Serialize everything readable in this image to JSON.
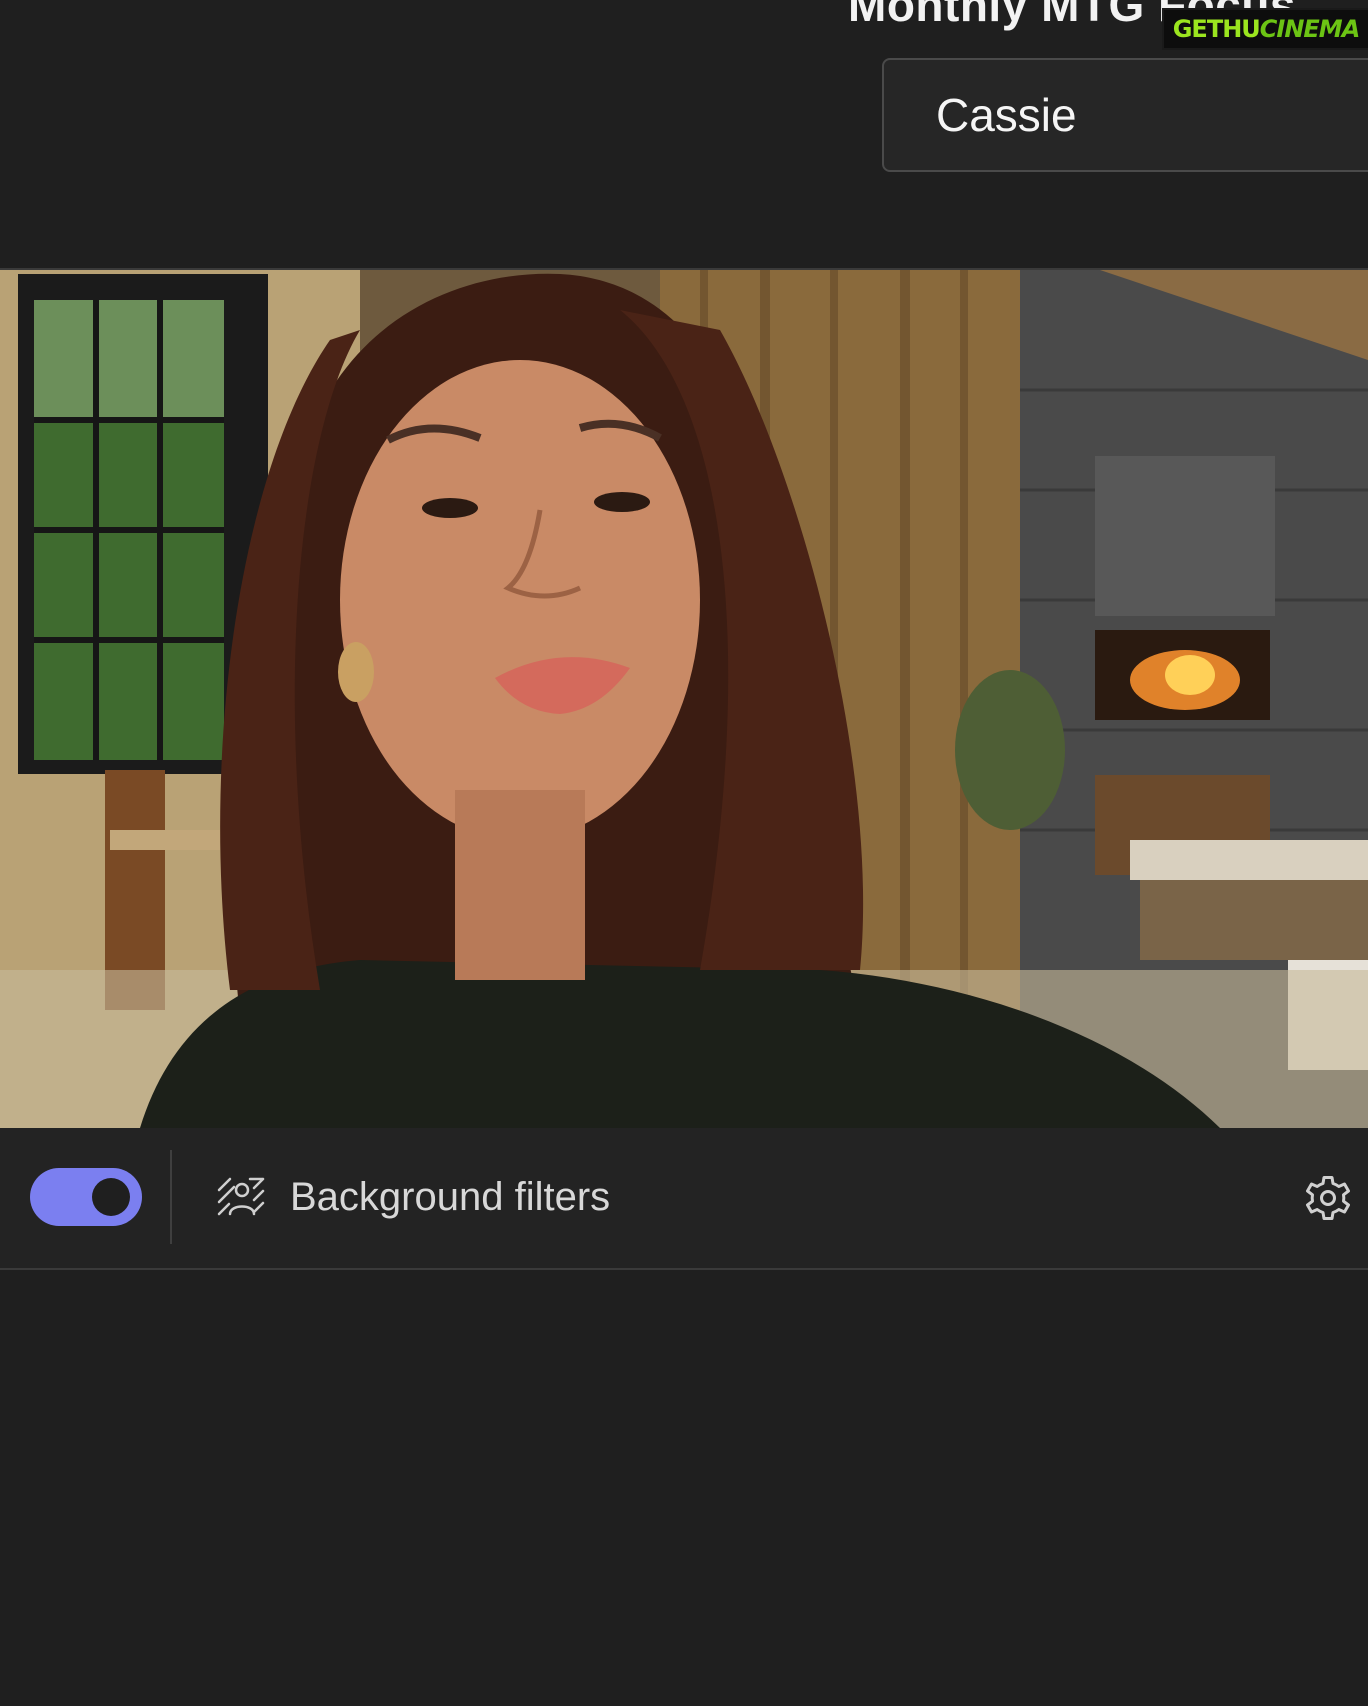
{
  "meeting": {
    "title": "Monthly MTG Focus"
  },
  "watermark": {
    "part1": "GETHU",
    "part2": "CINEMA"
  },
  "name_field": {
    "value": "Cassie"
  },
  "controls": {
    "video_toggle_on": true,
    "background_filters_label": "Background filters"
  },
  "icons": {
    "background_filters": "background-filters-icon",
    "settings": "gear-icon"
  },
  "colors": {
    "page_bg": "#1f1f1f",
    "toggle_accent": "#7b7ff0",
    "text": "#f2f2f2"
  }
}
